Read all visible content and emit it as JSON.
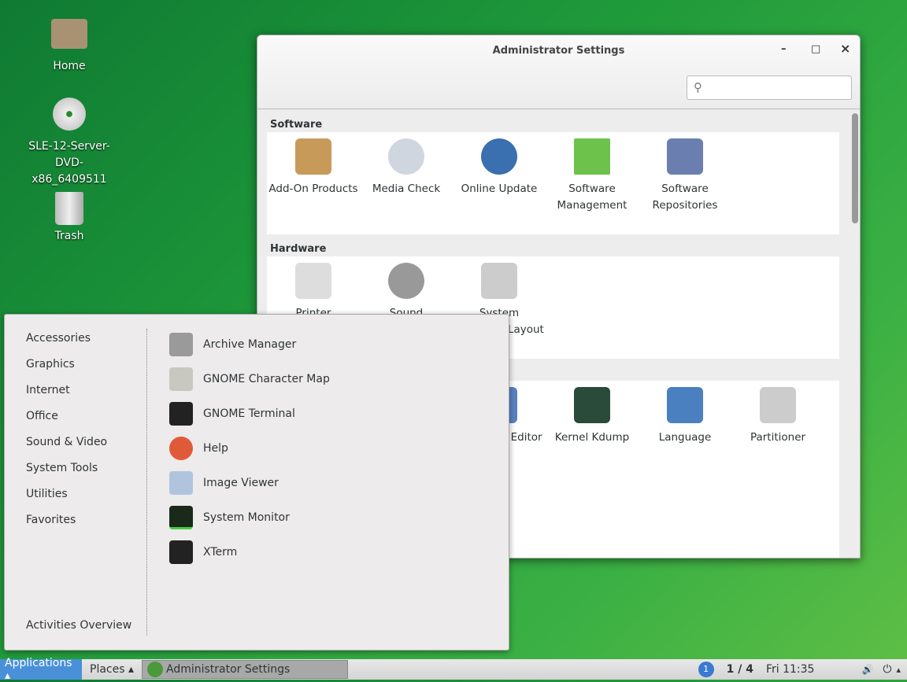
{
  "desktop": {
    "icons": [
      {
        "label": "Home"
      },
      {
        "label": "SLE-12-Server-DVD-x86_6409511"
      },
      {
        "label": "Trash"
      }
    ]
  },
  "window": {
    "title": "Administrator Settings",
    "minimize": "–",
    "maximize": "□",
    "close": "×",
    "search_placeholder": "",
    "sections": [
      {
        "title": "Software",
        "items": [
          "Add-On Products",
          "Media Check",
          "Online Update",
          "Software Management",
          "Software Repositories"
        ]
      },
      {
        "title": "Hardware",
        "items": [
          "Printer",
          "Sound",
          "System Keyboard Layout"
        ]
      },
      {
        "title": "System",
        "items": [
          "",
          "",
          "Sysconfig Editor",
          "Kernel Kdump",
          "Language",
          "Partitioner"
        ]
      }
    ]
  },
  "menu": {
    "categories": [
      "Accessories",
      "Graphics",
      "Internet",
      "Office",
      "Sound & Video",
      "System Tools",
      "Utilities",
      "Favorites"
    ],
    "activities": "Activities Overview",
    "apps": [
      {
        "label": "Archive Manager",
        "color": "#9a9a9a"
      },
      {
        "label": "GNOME Character Map",
        "color": "#c8c8c0"
      },
      {
        "label": "GNOME Terminal",
        "color": "#222"
      },
      {
        "label": "Help",
        "color": "#e05a3a"
      },
      {
        "label": "Image Viewer",
        "color": "#b0c4de"
      },
      {
        "label": "System Monitor",
        "color": "#1a2a1a"
      },
      {
        "label": "XTerm",
        "color": "#222"
      }
    ]
  },
  "panel": {
    "applications": "Applications ▴",
    "places": "Places ▴",
    "task": "Administrator Settings",
    "workspace_badge": "1",
    "workspace": "1 / 4",
    "clock": "Fri 11:35",
    "volume_icon": "🔊",
    "power_icon": "⏻",
    "arrow": "▴"
  }
}
